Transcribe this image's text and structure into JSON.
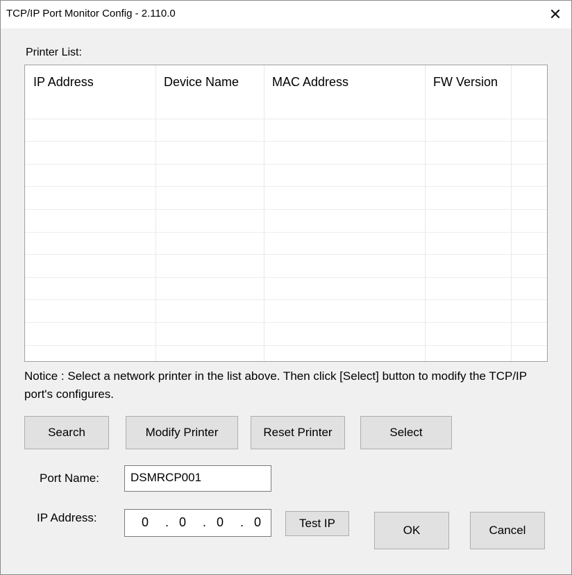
{
  "window": {
    "title": "TCP/IP Port Monitor Config - 2.110.0",
    "close_glyph": "✕"
  },
  "printer_list": {
    "label": "Printer List:",
    "columns": [
      "IP Address",
      "Device Name",
      "MAC Address",
      "FW Version"
    ],
    "rows": []
  },
  "notice": "Notice : Select a network printer in the list above. Then click [Select] button to modify the TCP/IP port's configures.",
  "buttons": {
    "search": "Search",
    "modify_printer": "Modify Printer",
    "reset_printer": "Reset Printer",
    "select": "Select",
    "test_ip": "Test IP",
    "ok": "OK",
    "cancel": "Cancel"
  },
  "port_name": {
    "label": "Port Name:",
    "value": "DSMRCP001"
  },
  "ip_address": {
    "label": "IP Address:",
    "octets": [
      "0",
      "0",
      "0",
      "0"
    ],
    "separator": "."
  }
}
